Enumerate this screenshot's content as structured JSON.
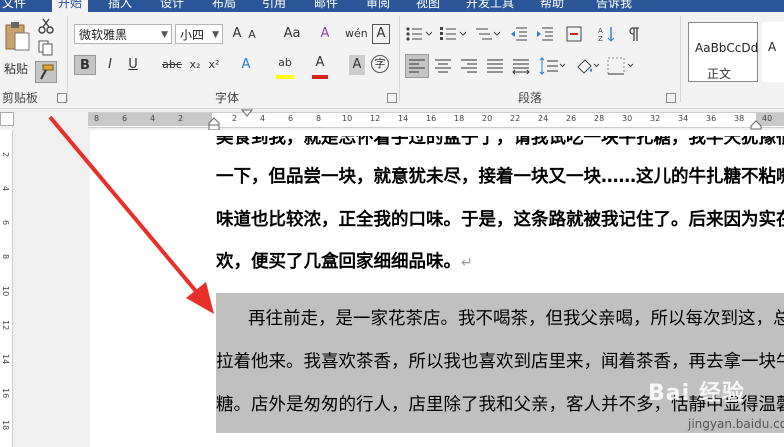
{
  "tabs": [
    "文件",
    "开始",
    "插入",
    "设计",
    "布局",
    "引用",
    "邮件",
    "审阅",
    "视图",
    "开发工具",
    "帮助",
    "告诉我"
  ],
  "clipboard": {
    "paste_label": "粘贴",
    "group_label": "剪贴板"
  },
  "font": {
    "family": "微软雅黑",
    "size": "小四",
    "group_label": "字体",
    "bold": "B",
    "italic": "I",
    "underline": "U",
    "strike": "abc",
    "subscript": "x₂",
    "superscript": "x²",
    "grow": "A",
    "shrink": "A",
    "case": "Aa",
    "clear": "A",
    "phonetic": "wén",
    "border_char": "A",
    "highlight": "ab",
    "color_a": "A",
    "shade_a": "A",
    "circle": "字"
  },
  "paragraph": {
    "group_label": "段落"
  },
  "styles": {
    "preview": "AaBbCcDd",
    "name": "正文",
    "preview2": "A"
  },
  "ruler": {
    "numbers": [
      "8",
      "6",
      "4",
      "2",
      "2",
      "4",
      "6",
      "8",
      "10",
      "12",
      "14",
      "16",
      "18",
      "20",
      "22",
      "24",
      "26",
      "28",
      "30",
      "32",
      "34",
      "36",
      "38",
      "40"
    ]
  },
  "vruler": {
    "numbers": [
      "2",
      "4",
      "6",
      "8",
      "10",
      "12",
      "14",
      "16",
      "18"
    ]
  },
  "document": {
    "line0": "美食到我，就是忘怀着手过的盆子了，请我试吃一块牛扎糖，我半天犹豫很成份",
    "line1": "一下，但品尝一块，就意犹未尽，接着一块又一块……这儿的牛扎糖不粘嘴，",
    "line2": "味道也比较浓，正全我的口味。于是，这条路就被我记住了。后来因为实在喜",
    "line3": "欢，便买了几盒回家细细品味。",
    "mark": "↵",
    "p2_line1": "再往前走，是一家花茶店。我不喝茶，但我父亲喝，所以每次到这，总是",
    "p2_line2": "拉着他来。我喜欢茶香，所以我也喜欢到店里来，闻着茶香，再去拿一块牛扎",
    "p2_line3": "糖。店外是匆匆的行人，店里除了我和父亲，客人并不多，恬静中显得温馨",
    "p2_mark": "↵"
  },
  "watermark": {
    "big": "Bai 经验",
    "small": "jingyan.baidu.com"
  },
  "colors": {
    "ribbon_blue": "#2b579a",
    "arrow_red": "#e8302a",
    "highlight_gray": "#c0c0c0",
    "font_red": "#d22",
    "highlight_yellow": "#ffff00"
  }
}
